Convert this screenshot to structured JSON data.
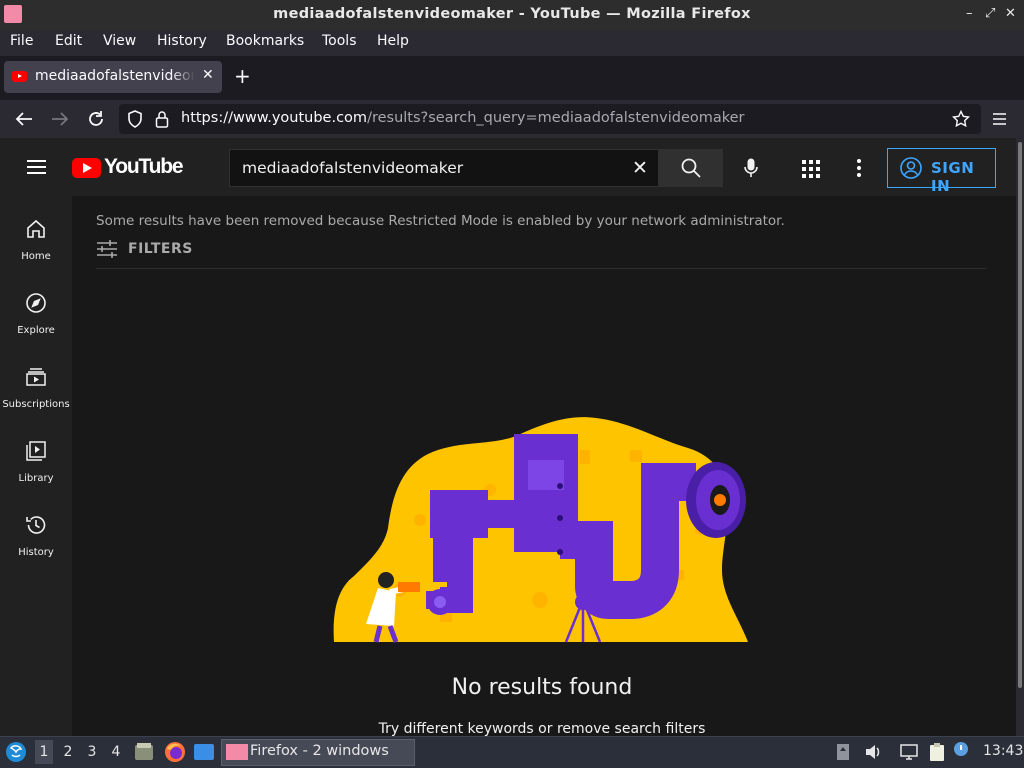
{
  "window": {
    "title": "mediaadofalstenvideomaker - YouTube — Mozilla Firefox"
  },
  "menu": [
    "File",
    "Edit",
    "View",
    "History",
    "Bookmarks",
    "Tools",
    "Help"
  ],
  "tab": {
    "title": "mediaadofalstenvideomaker - YouTube"
  },
  "nav": {
    "url_host": "https://www.youtube.com",
    "url_path": "/results?search_query=mediaadofalstenvideomaker"
  },
  "youtube": {
    "logo_text": "YouTube",
    "search_value": "mediaadofalstenvideomaker",
    "sign_in": "SIGN IN",
    "sidebar": [
      {
        "label": "Home",
        "icon": "home-icon"
      },
      {
        "label": "Explore",
        "icon": "compass-icon"
      },
      {
        "label": "Subscriptions",
        "icon": "subscriptions-icon"
      },
      {
        "label": "Library",
        "icon": "library-icon"
      },
      {
        "label": "History",
        "icon": "history-icon"
      }
    ],
    "restricted_notice": "Some results have been removed because Restricted Mode is enabled by your network administrator.",
    "filters_label": "FILTERS",
    "no_results_title": "No results found",
    "no_results_hint": "Try different keywords or remove search filters"
  },
  "taskbar": {
    "workspaces": [
      "1",
      "2",
      "3",
      "4"
    ],
    "task_label": "Firefox - 2 windows",
    "clock": "13:43"
  },
  "colors": {
    "yt_red": "#ff0000",
    "link_blue": "#3ea6ff",
    "illustration_yellow": "#ffc400",
    "illustration_purple": "#6a2fd0"
  }
}
